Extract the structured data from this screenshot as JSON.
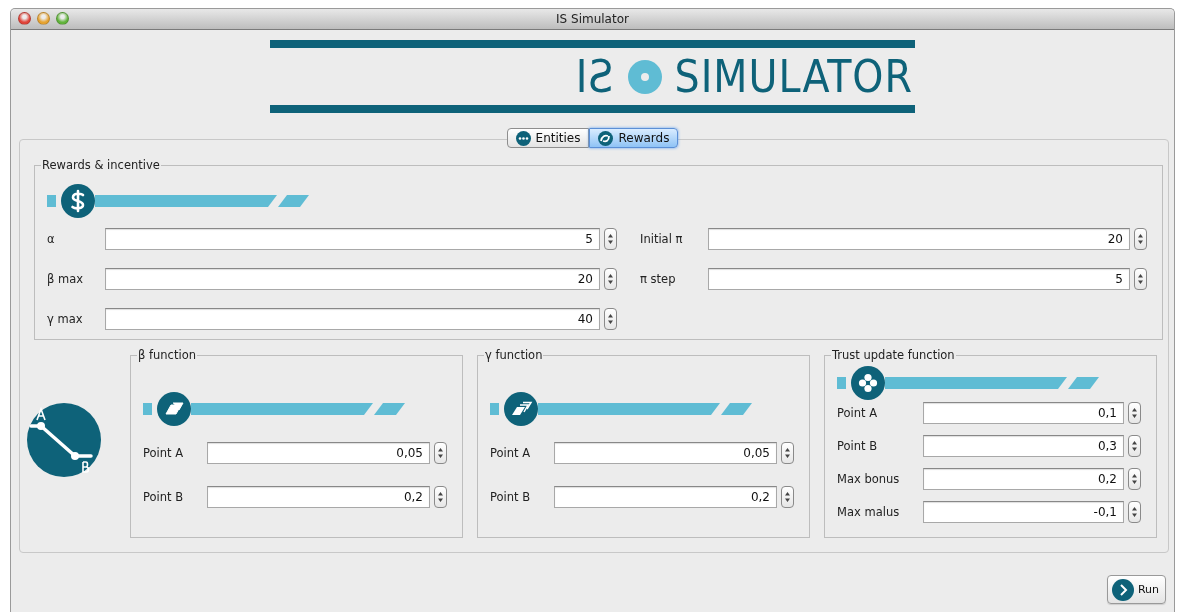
{
  "window": {
    "title": "IS Simulator"
  },
  "logo": {
    "left_text": "IƧ",
    "right_text": "SIMULATOR"
  },
  "tabs": [
    {
      "label": "Entities",
      "selected": false
    },
    {
      "label": "Rewards",
      "selected": true
    }
  ],
  "rewards": {
    "title": "Rewards & incentive",
    "left_fields": [
      {
        "label": "α",
        "value": "5"
      },
      {
        "label": "β max",
        "value": "20"
      },
      {
        "label": "γ max",
        "value": "40"
      }
    ],
    "right_fields": [
      {
        "label": "Initial π",
        "value": "20"
      },
      {
        "label": "π step",
        "value": "5"
      }
    ]
  },
  "functions": [
    {
      "title": "β function",
      "fields": [
        {
          "label": "Point A",
          "value": "0,05"
        },
        {
          "label": "Point B",
          "value": "0,2"
        }
      ]
    },
    {
      "title": "γ function",
      "fields": [
        {
          "label": "Point A",
          "value": "0,05"
        },
        {
          "label": "Point B",
          "value": "0,2"
        }
      ]
    },
    {
      "title": "Trust update function",
      "fields": [
        {
          "label": "Point A",
          "value": "0,1"
        },
        {
          "label": "Point B",
          "value": "0,3"
        },
        {
          "label": "Max bonus",
          "value": "0,2"
        },
        {
          "label": "Max malus",
          "value": "-0,1"
        }
      ]
    }
  ],
  "run_button": {
    "label": "Run"
  }
}
